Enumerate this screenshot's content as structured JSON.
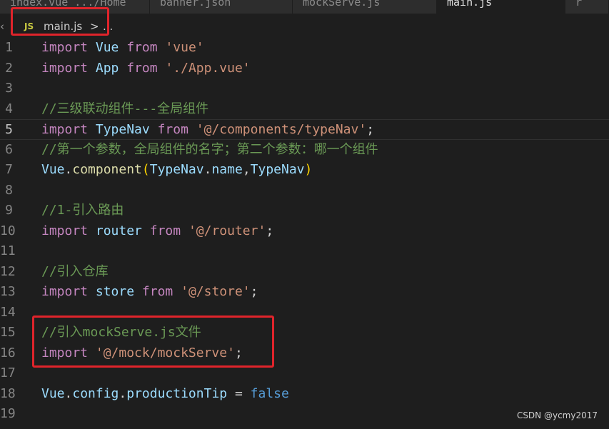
{
  "tabs": [
    {
      "label": "index.vue .../Home"
    },
    {
      "label": "banner.json"
    },
    {
      "label": "mockServe.js"
    },
    {
      "label": "main.js",
      "active": true
    },
    {
      "label": "r"
    }
  ],
  "breadcrumb": {
    "file_badge": "JS",
    "file": "main.js",
    "sep": ">",
    "more": "..."
  },
  "lines": [
    {
      "n": "1",
      "tokens": [
        [
          "kw",
          "import"
        ],
        [
          "pl",
          " "
        ],
        [
          "id",
          "Vue"
        ],
        [
          "pl",
          " "
        ],
        [
          "kw",
          "from"
        ],
        [
          "pl",
          " "
        ],
        [
          "str",
          "'vue'"
        ]
      ]
    },
    {
      "n": "2",
      "tokens": [
        [
          "kw",
          "import"
        ],
        [
          "pl",
          " "
        ],
        [
          "id",
          "App"
        ],
        [
          "pl",
          " "
        ],
        [
          "kw",
          "from"
        ],
        [
          "pl",
          " "
        ],
        [
          "str",
          "'./App.vue'"
        ]
      ]
    },
    {
      "n": "3",
      "tokens": []
    },
    {
      "n": "4",
      "tokens": [
        [
          "cm",
          "//三级联动组件---全局组件"
        ]
      ]
    },
    {
      "n": "5",
      "tokens": [
        [
          "kw",
          "import"
        ],
        [
          "pl",
          " "
        ],
        [
          "id",
          "TypeNav"
        ],
        [
          "pl",
          " "
        ],
        [
          "kw",
          "from"
        ],
        [
          "pl",
          " "
        ],
        [
          "str",
          "'@/components/typeNav'"
        ],
        [
          "pl",
          ";"
        ]
      ],
      "current": true
    },
    {
      "n": "6",
      "tokens": [
        [
          "cm",
          "//第一个参数，全局组件的名字；第二个参数：哪一个组件"
        ]
      ]
    },
    {
      "n": "7",
      "tokens": [
        [
          "id",
          "Vue"
        ],
        [
          "pl",
          "."
        ],
        [
          "fn",
          "component"
        ],
        [
          "br",
          "("
        ],
        [
          "id",
          "TypeNav"
        ],
        [
          "pl",
          "."
        ],
        [
          "id",
          "name"
        ],
        [
          "pl",
          ","
        ],
        [
          "id",
          "TypeNav"
        ],
        [
          "br",
          ")"
        ]
      ]
    },
    {
      "n": "8",
      "tokens": []
    },
    {
      "n": "9",
      "tokens": [
        [
          "cm",
          "//1-引入路由"
        ]
      ]
    },
    {
      "n": "10",
      "tokens": [
        [
          "kw",
          "import"
        ],
        [
          "pl",
          " "
        ],
        [
          "id",
          "router"
        ],
        [
          "pl",
          " "
        ],
        [
          "kw",
          "from"
        ],
        [
          "pl",
          " "
        ],
        [
          "str",
          "'@/router'"
        ],
        [
          "pl",
          ";"
        ]
      ]
    },
    {
      "n": "11",
      "tokens": []
    },
    {
      "n": "12",
      "tokens": [
        [
          "cm",
          "//引入仓库"
        ]
      ]
    },
    {
      "n": "13",
      "tokens": [
        [
          "kw",
          "import"
        ],
        [
          "pl",
          " "
        ],
        [
          "id",
          "store"
        ],
        [
          "pl",
          " "
        ],
        [
          "kw",
          "from"
        ],
        [
          "pl",
          " "
        ],
        [
          "str",
          "'@/store'"
        ],
        [
          "pl",
          ";"
        ]
      ]
    },
    {
      "n": "14",
      "tokens": []
    },
    {
      "n": "15",
      "tokens": [
        [
          "cm",
          "//引入mockServe.js文件"
        ]
      ]
    },
    {
      "n": "16",
      "tokens": [
        [
          "kw",
          "import"
        ],
        [
          "pl",
          " "
        ],
        [
          "str",
          "'@/mock/mockServe'"
        ],
        [
          "pl",
          ";"
        ]
      ]
    },
    {
      "n": "17",
      "tokens": []
    },
    {
      "n": "18",
      "tokens": [
        [
          "id",
          "Vue"
        ],
        [
          "pl",
          "."
        ],
        [
          "id",
          "config"
        ],
        [
          "pl",
          "."
        ],
        [
          "id",
          "productionTip"
        ],
        [
          "pl",
          " = "
        ],
        [
          "bool",
          "false"
        ]
      ]
    },
    {
      "n": "19",
      "tokens": []
    }
  ],
  "colors": {
    "annotation": "#e0242b",
    "keyword": "#c586c0",
    "string": "#ce9178",
    "comment": "#6a9955"
  },
  "watermark": "CSDN @ycmy2017"
}
